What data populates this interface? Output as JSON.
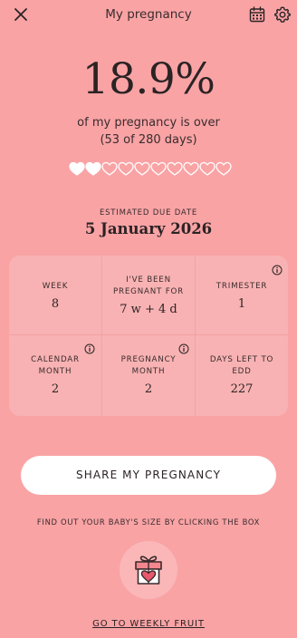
{
  "header": {
    "title": "My pregnancy",
    "close_icon": "close-icon",
    "calendar_icon": "calendar-icon",
    "settings_icon": "gear-icon"
  },
  "progress": {
    "percent_text": "18.9%",
    "percent_value": 18.9,
    "subtitle": "of my pregnancy is over",
    "days_text": "(53 of 280 days)",
    "hearts_total": 10,
    "hearts_filled": 2
  },
  "due": {
    "label": "ESTIMATED DUE DATE",
    "date": "5 January 2026"
  },
  "stats": [
    {
      "label": "WEEK",
      "value": "8",
      "info": false
    },
    {
      "label": "I'VE BEEN\nPREGNANT FOR",
      "value": "7 w + 4 d",
      "info": false
    },
    {
      "label": "TRIMESTER",
      "value": "1",
      "info": true
    },
    {
      "label": "CALENDAR\nMONTH",
      "value": "2",
      "info": true
    },
    {
      "label": "PREGNANCY\nMONTH",
      "value": "2",
      "info": true
    },
    {
      "label": "DAYS LEFT TO\nEDD",
      "value": "227",
      "info": false
    }
  ],
  "actions": {
    "share_label": "SHARE MY PREGNANCY",
    "hint": "FIND OUT YOUR BABY'S SIZE BY CLICKING THE BOX",
    "gift_icon": "gift-icon",
    "weekly_link": "GO TO WEEKLY FRUIT"
  },
  "colors": {
    "background": "#f9a3a5",
    "card": "#f8b2b3",
    "accent": "#e25a6a",
    "text": "#2b2324"
  }
}
